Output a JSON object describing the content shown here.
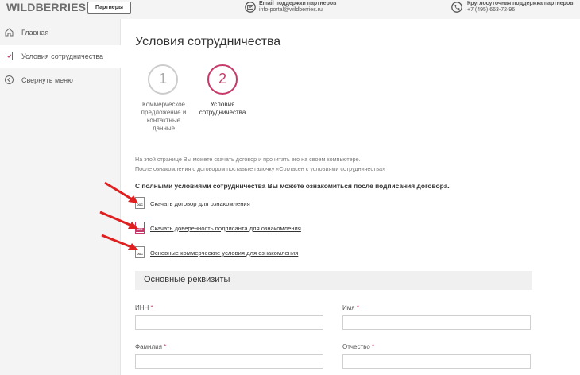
{
  "header": {
    "logo": "WILDBERRIES",
    "partners_button": "Партнеры",
    "email_support": {
      "label": "Email поддержки партнеров",
      "value": "info-portal@wildberries.ru",
      "icon": "envelope-icon"
    },
    "phone_support": {
      "label": "Круглосуточная поддержка партнеров",
      "value": "+7 (495) 663-72-96",
      "icon": "phone-icon"
    }
  },
  "sidebar": {
    "items": [
      {
        "label": "Главная",
        "icon": "home-icon"
      },
      {
        "label": "Условия сотрудничества",
        "icon": "checklist-icon",
        "active": true
      },
      {
        "label": "Свернуть меню",
        "icon": "chevron-left-icon"
      }
    ]
  },
  "main": {
    "title": "Условия сотрудничества",
    "steps": [
      {
        "number": "1",
        "label_lines": [
          "Коммерческое",
          "предложение и",
          "контактные",
          "данные"
        ]
      },
      {
        "number": "2",
        "label_lines": [
          "Условия",
          "сотрудничества"
        ],
        "active": true
      }
    ],
    "info_line1": "На этой странице Вы можете скачать договор и прочитать его на своем компьютере.",
    "info_line2": "После ознакомления с договором поставьте галочку «Согласен с условиями сотрудничества»",
    "bold_notice": "С полными условиями сотрудничества Вы можете ознакомиться после подписания договора.",
    "documents": [
      {
        "tag": "DOC",
        "label": "Скачать договор для ознакомления"
      },
      {
        "tag": "PDF",
        "label": "Скачать доверенность подписанта для ознакомления"
      },
      {
        "tag": "DOC",
        "label": "Основные коммерческие условия для ознакомления"
      }
    ],
    "section_title": "Основные реквизиты",
    "fields": {
      "inn": {
        "label": "ИНН",
        "required": "*",
        "value": ""
      },
      "name": {
        "label": "Имя",
        "required": "*",
        "value": ""
      },
      "surname": {
        "label": "Фамилия",
        "required": "*",
        "value": ""
      },
      "patronymic": {
        "label": "Отчество",
        "required": "*",
        "value": ""
      }
    }
  },
  "colors": {
    "accent": "#c6396a",
    "arrow": "#e02020"
  }
}
